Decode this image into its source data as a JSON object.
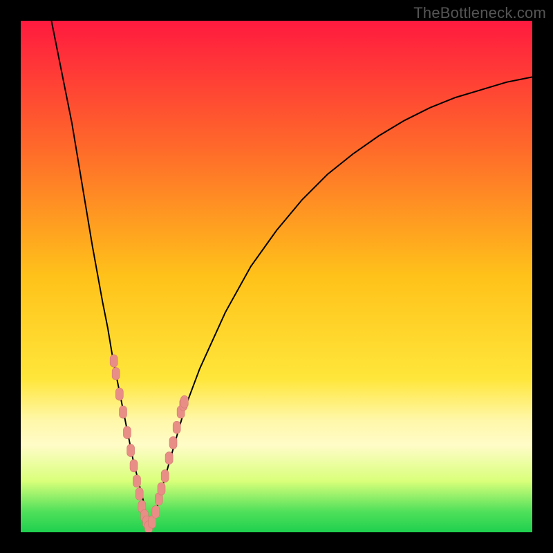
{
  "watermark": "TheBottleneck.com",
  "colors": {
    "gradient_stops": [
      {
        "offset": 0.0,
        "color": "#ff1a3f"
      },
      {
        "offset": 0.25,
        "color": "#ff6a2a"
      },
      {
        "offset": 0.5,
        "color": "#ffc21a"
      },
      {
        "offset": 0.7,
        "color": "#ffe63a"
      },
      {
        "offset": 0.78,
        "color": "#fff7a8"
      },
      {
        "offset": 0.83,
        "color": "#fffcc8"
      },
      {
        "offset": 0.9,
        "color": "#d9ff7a"
      },
      {
        "offset": 0.96,
        "color": "#4fe05a"
      },
      {
        "offset": 1.0,
        "color": "#1fd04f"
      }
    ],
    "curve": "#000000",
    "marker_fill": "#e98e86",
    "marker_stroke": "#d47a72",
    "frame": "#000000"
  },
  "chart_data": {
    "type": "line",
    "title": "",
    "xlabel": "",
    "ylabel": "",
    "xlim": [
      0,
      100
    ],
    "ylim": [
      0,
      100
    ],
    "series": [
      {
        "name": "left-branch",
        "x": [
          6,
          8,
          10,
          12,
          14,
          16,
          17,
          18,
          19,
          20,
          21,
          22,
          23,
          24,
          24.5,
          25
        ],
        "y": [
          100,
          90,
          80,
          68,
          56,
          45,
          40,
          34,
          29,
          24,
          19,
          14,
          10,
          6,
          3,
          1
        ]
      },
      {
        "name": "right-branch",
        "x": [
          25,
          26,
          27,
          28,
          30,
          32,
          35,
          40,
          45,
          50,
          55,
          60,
          65,
          70,
          75,
          80,
          85,
          90,
          95,
          100
        ],
        "y": [
          1,
          3,
          6,
          10,
          17,
          24,
          32,
          43,
          52,
          59,
          65,
          70,
          74,
          77.5,
          80.5,
          83,
          85,
          86.5,
          88,
          89
        ]
      }
    ],
    "markers": {
      "name": "sample-points",
      "x": [
        18.2,
        18.6,
        19.3,
        20.0,
        20.8,
        21.5,
        22.1,
        22.7,
        23.2,
        23.7,
        24.2,
        24.6,
        25.0,
        25.7,
        26.4,
        27.0,
        27.5,
        28.2,
        29.0,
        29.8,
        30.5,
        31.3,
        31.8,
        32.0
      ],
      "y": [
        33.5,
        31.0,
        27.0,
        23.5,
        19.5,
        16.0,
        13.0,
        10.0,
        7.5,
        5.0,
        3.2,
        2.0,
        1.0,
        2.0,
        4.0,
        6.5,
        8.5,
        11.0,
        14.5,
        17.5,
        20.5,
        23.5,
        25.0,
        25.5
      ]
    },
    "valley_x": 25
  }
}
